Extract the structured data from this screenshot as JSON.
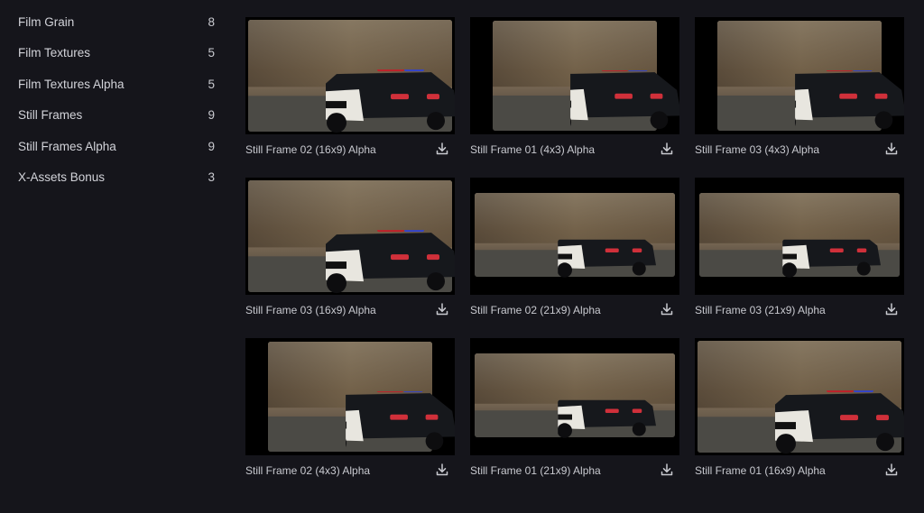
{
  "sidebar": {
    "items": [
      {
        "label": "Film Grain",
        "count": "8"
      },
      {
        "label": "Film Textures",
        "count": "5"
      },
      {
        "label": "Film Textures Alpha",
        "count": "5"
      },
      {
        "label": "Still Frames",
        "count": "9"
      },
      {
        "label": "Still Frames Alpha",
        "count": "9"
      },
      {
        "label": "X-Assets Bonus",
        "count": "3"
      }
    ]
  },
  "grid": {
    "items": [
      {
        "title": "Still Frame 02 (16x9) Alpha",
        "aspect": "16x9",
        "icon": "download-icon"
      },
      {
        "title": "Still Frame 01 (4x3) Alpha",
        "aspect": "4x3",
        "icon": "download-icon"
      },
      {
        "title": "Still Frame 03 (4x3) Alpha",
        "aspect": "4x3",
        "icon": "download-icon"
      },
      {
        "title": "Still Frame 03 (16x9) Alpha",
        "aspect": "16x9",
        "icon": "download-icon"
      },
      {
        "title": "Still Frame 02 (21x9) Alpha",
        "aspect": "21x9",
        "icon": "download-icon"
      },
      {
        "title": "Still Frame 03 (21x9) Alpha",
        "aspect": "21x9",
        "icon": "download-icon"
      },
      {
        "title": "Still Frame 02 (4x3) Alpha",
        "aspect": "4x3",
        "icon": "download-icon"
      },
      {
        "title": "Still Frame 01 (21x9) Alpha",
        "aspect": "21x9",
        "icon": "download-icon"
      },
      {
        "title": "Still Frame 01 (16x9) Alpha",
        "aspect": "16x9",
        "icon": "download-icon"
      }
    ]
  },
  "colors": {
    "background": "#15151b",
    "text": "#cfd0d6"
  }
}
